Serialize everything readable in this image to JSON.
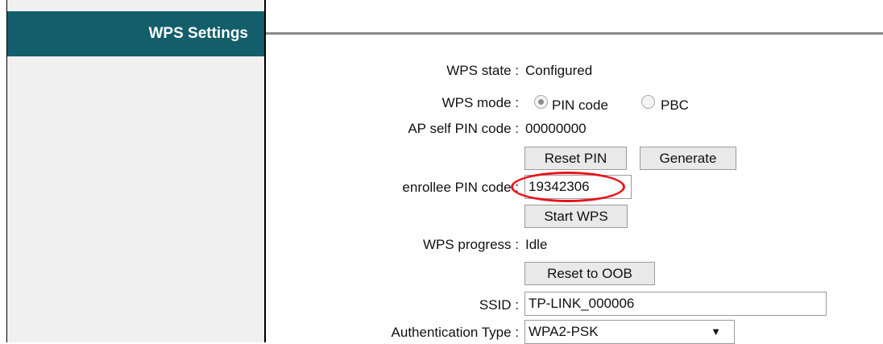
{
  "sidebar": {
    "title": "WPS Settings"
  },
  "form": {
    "wps_state_label": "WPS state :",
    "wps_state_value": "Configured",
    "wps_mode_label": "WPS mode :",
    "wps_mode_options": [
      {
        "label": "PIN code",
        "selected": true
      },
      {
        "label": "PBC",
        "selected": false
      }
    ],
    "ap_pin_label": "AP self PIN code :",
    "ap_pin_value": "00000000",
    "reset_pin_button": "Reset PIN",
    "generate_button": "Generate",
    "enrollee_pin_label": "enrollee PIN code :",
    "enrollee_pin_value": "19342306",
    "start_wps_button": "Start WPS",
    "wps_progress_label": "WPS progress :",
    "wps_progress_value": "Idle",
    "reset_oob_button": "Reset to OOB",
    "ssid_label": "SSID :",
    "ssid_value": "TP-LINK_000006",
    "auth_type_label": "Authentication Type :",
    "auth_type_value": "WPA2-PSK"
  },
  "colors": {
    "header_bg": "#125e6b",
    "highlight": "#e8141b"
  }
}
